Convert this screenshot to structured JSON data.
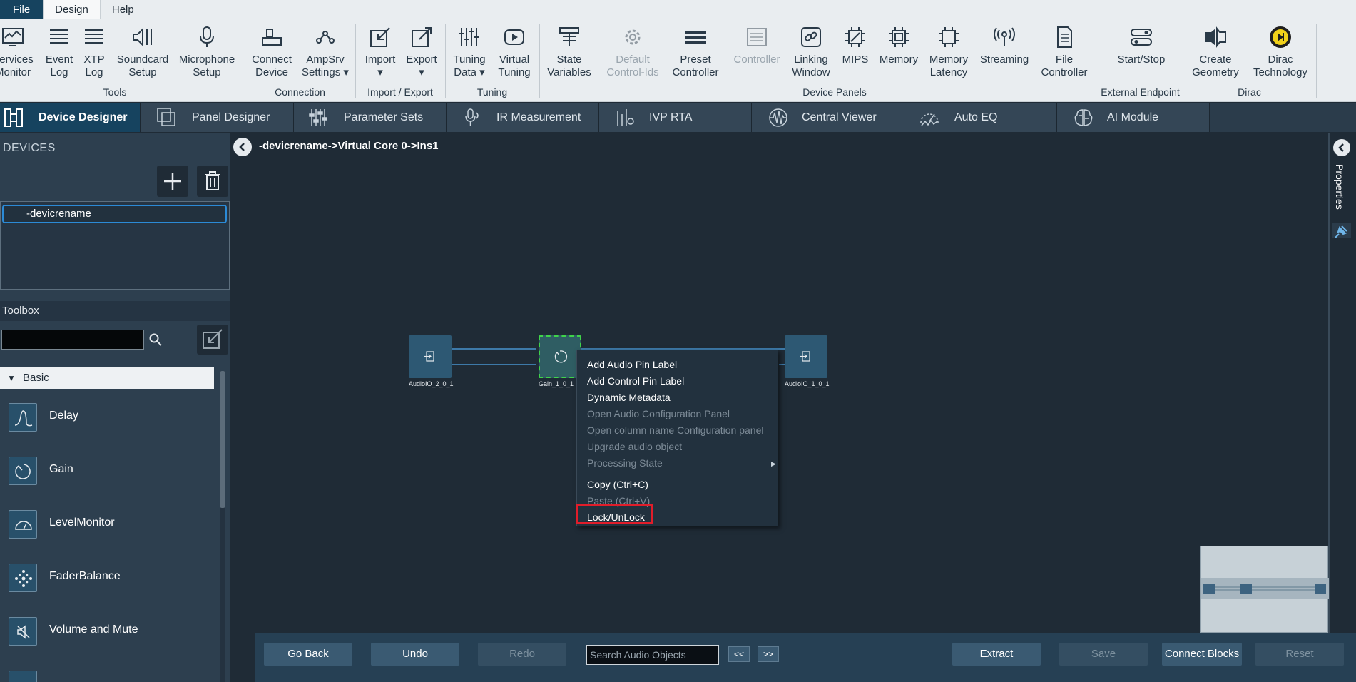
{
  "menubar": {
    "file": "File",
    "design": "Design",
    "help": "Help"
  },
  "ribbon": {
    "buttons": [
      {
        "l1": "Services",
        "l2": "Monitor"
      },
      {
        "l1": "Event",
        "l2": "Log"
      },
      {
        "l1": "XTP",
        "l2": "Log"
      },
      {
        "l1": "Soundcard",
        "l2": "Setup"
      },
      {
        "l1": "Microphone",
        "l2": "Setup"
      },
      {
        "l1": "Connect",
        "l2": "Device"
      },
      {
        "l1": "AmpSrv",
        "l2": "Settings ▾"
      },
      {
        "l1": "Import",
        "l2": "▾"
      },
      {
        "l1": "Export",
        "l2": "▾"
      },
      {
        "l1": "Tuning",
        "l2": "Data ▾"
      },
      {
        "l1": "Virtual",
        "l2": "Tuning"
      },
      {
        "l1": "State",
        "l2": "Variables"
      },
      {
        "l1": "Default",
        "l2": "Control-Ids"
      },
      {
        "l1": "Preset",
        "l2": "Controller"
      },
      {
        "l1": "Controller",
        "l2": ""
      },
      {
        "l1": "Linking",
        "l2": "Window"
      },
      {
        "l1": "MIPS",
        "l2": ""
      },
      {
        "l1": "Memory",
        "l2": ""
      },
      {
        "l1": "Memory",
        "l2": "Latency"
      },
      {
        "l1": "Streaming",
        "l2": ""
      },
      {
        "l1": "File",
        "l2": "Controller"
      },
      {
        "l1": "Start/Stop",
        "l2": ""
      },
      {
        "l1": "Create",
        "l2": "Geometry"
      },
      {
        "l1": "Dirac",
        "l2": "Technology"
      }
    ],
    "groups": {
      "tools": "Tools",
      "connection": "Connection",
      "import_export": "Import / Export",
      "tuning": "Tuning",
      "device_panels": "Device Panels",
      "external_endpoint": "External Endpoint",
      "dirac": "Dirac"
    }
  },
  "tabs": [
    "Device Designer",
    "Panel Designer",
    "Parameter Sets",
    "IR Measurement",
    "IVP RTA",
    "Central Viewer",
    "Auto EQ",
    "AI Module"
  ],
  "left": {
    "devices_header": "DEVICES",
    "device_item": "-devicrename",
    "toolbox_header": "Toolbox",
    "toolbox_search_value": "",
    "basic_header": "Basic",
    "items": [
      "Delay",
      "Gain",
      "LevelMonitor",
      "FaderBalance",
      "Volume and Mute"
    ]
  },
  "canvas": {
    "breadcrumb": "-devicrename->Virtual Core 0->Ins1",
    "blocks": [
      "AudioIO_2_0_1",
      "Gain_1_0_1",
      "AudioIO_1_0_1"
    ]
  },
  "context_menu": {
    "items": [
      "Add Audio Pin Label",
      "Add Control Pin Label",
      "Dynamic Metadata",
      "Open Audio Configuration Panel",
      "Open column name Configuration panel",
      "Upgrade audio object",
      "Processing State",
      "Copy (Ctrl+C)",
      "Paste (Ctrl+V)",
      "Lock/UnLock"
    ]
  },
  "right": {
    "properties_label": "Properties"
  },
  "bottom": {
    "go_back": "Go Back",
    "undo": "Undo",
    "redo": "Redo",
    "search_placeholder": "Search Audio Objects",
    "prev": "<<",
    "next": ">>",
    "extract": "Extract",
    "save": "Save",
    "connect_blocks": "Connect Blocks",
    "reset": "Reset"
  },
  "colors": {
    "accent": "#16435f",
    "highlight": "#e11d2a",
    "selection": "#3fd34a"
  }
}
